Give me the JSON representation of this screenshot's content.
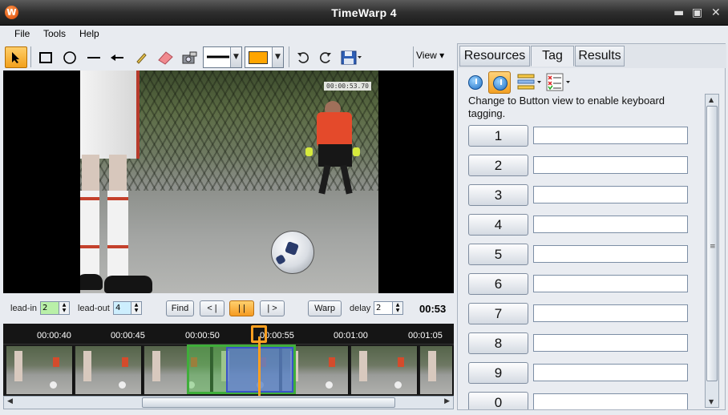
{
  "window": {
    "title": "TimeWarp 4",
    "icon": "W",
    "minimize": "▬",
    "maximize": "▣",
    "close": "✕"
  },
  "menu": {
    "file": "File",
    "tools": "Tools",
    "help": "Help"
  },
  "toolbar": {
    "view_label": "View ▾",
    "line_color": "#000000",
    "fill_color": "#ffa500"
  },
  "video": {
    "timestamp": "00:00:53.70"
  },
  "controls": {
    "lead_in_label": "lead-in",
    "lead_in_value": "2",
    "lead_out_label": "lead-out",
    "lead_out_value": "4",
    "find_label": "Find",
    "prev_label": "< |",
    "pause_label": "| |",
    "next_label": "| >",
    "warp_label": "Warp",
    "delay_label": "delay",
    "delay_value": "2",
    "timecode": "00:53"
  },
  "timeline": {
    "ticks": [
      "00:00:40",
      "00:00:45",
      "00:00:50",
      "00:00:55",
      "00:01:00",
      "00:01:05"
    ]
  },
  "panel": {
    "tabs": [
      "Resources",
      "Tag",
      "Results"
    ],
    "active_tab": "Tag",
    "hint": "Change to Button view to enable keyboard tagging.",
    "tag_buttons": [
      "1",
      "2",
      "3",
      "4",
      "5",
      "6",
      "7",
      "8",
      "9",
      "0"
    ]
  }
}
